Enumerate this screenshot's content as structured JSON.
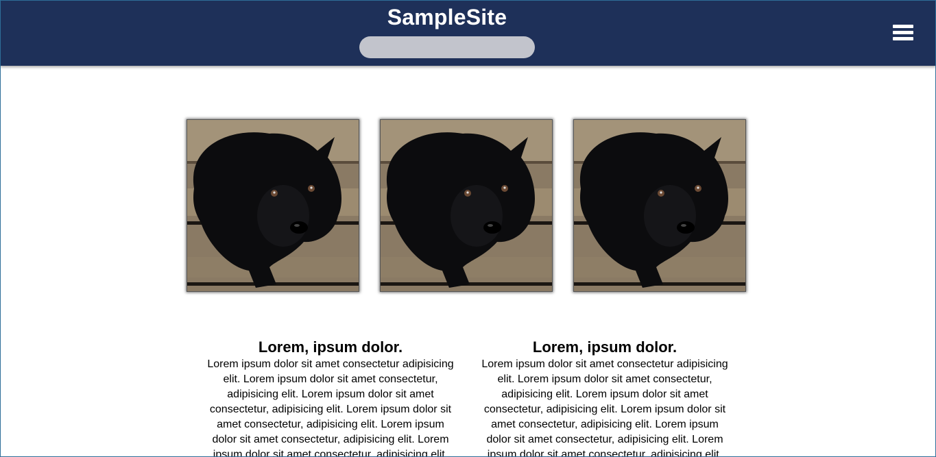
{
  "header": {
    "title": "SampleSite",
    "search_placeholder": ""
  },
  "menu": {
    "icon": "hamburger-menu-icon"
  },
  "gallery": {
    "images": [
      {
        "subject": "black-puppy-photo"
      },
      {
        "subject": "black-puppy-photo"
      },
      {
        "subject": "black-puppy-photo"
      }
    ]
  },
  "articles": [
    {
      "heading": "Lorem, ipsum dolor.",
      "body": "Lorem ipsum dolor sit amet consectetur adipisicing elit. Lorem ipsum dolor sit amet consectetur, adipisicing elit. Lorem ipsum dolor sit amet consectetur, adipisicing elit. Lorem ipsum dolor sit amet consectetur, adipisicing elit. Lorem ipsum dolor sit amet consectetur, adipisicing elit. Lorem ipsum dolor sit amet consectetur, adipisicing elit."
    },
    {
      "heading": "Lorem, ipsum dolor.",
      "body": "Lorem ipsum dolor sit amet consectetur adipisicing elit. Lorem ipsum dolor sit amet consectetur, adipisicing elit. Lorem ipsum dolor sit amet consectetur, adipisicing elit. Lorem ipsum dolor sit amet consectetur, adipisicing elit. Lorem ipsum dolor sit amet consectetur, adipisicing elit. Lorem ipsum dolor sit amet consectetur, adipisicing elit."
    }
  ],
  "colors": {
    "header_bg": "#1e3059",
    "search_bg": "#c2c4cc",
    "text": "#000000"
  }
}
